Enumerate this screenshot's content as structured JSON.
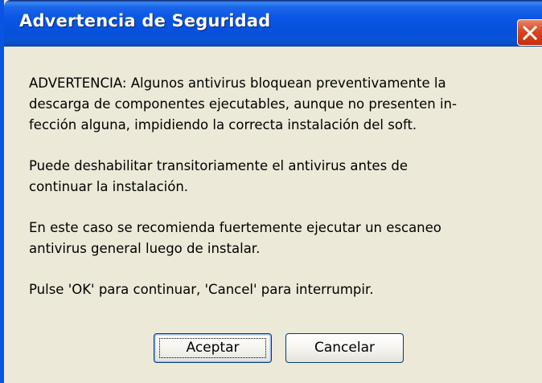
{
  "dialog": {
    "title": "Advertencia de Seguridad",
    "paragraphs": [
      "ADVERTENCIA: Algunos antivirus bloquean preventivamente la\ndescarga de componentes ejecutables, aunque no presenten in-\nfección alguna, impidiendo la correcta instalación del soft.",
      "Puede deshabilitar transitoriamente el antivirus antes de\ncontinuar la instalación.",
      "En este caso se recomienda fuertemente ejecutar un escaneo\nantivirus general luego de instalar.",
      "Pulse 'OK' para continuar, 'Cancel' para interrumpir."
    ],
    "buttons": {
      "ok_label": "Aceptar",
      "cancel_label": "Cancelar"
    },
    "icons": {
      "close": "close-icon"
    },
    "colors": {
      "titlebar": "#0a56e6",
      "close_button": "#d9461f",
      "body": "#ece9d8"
    }
  }
}
